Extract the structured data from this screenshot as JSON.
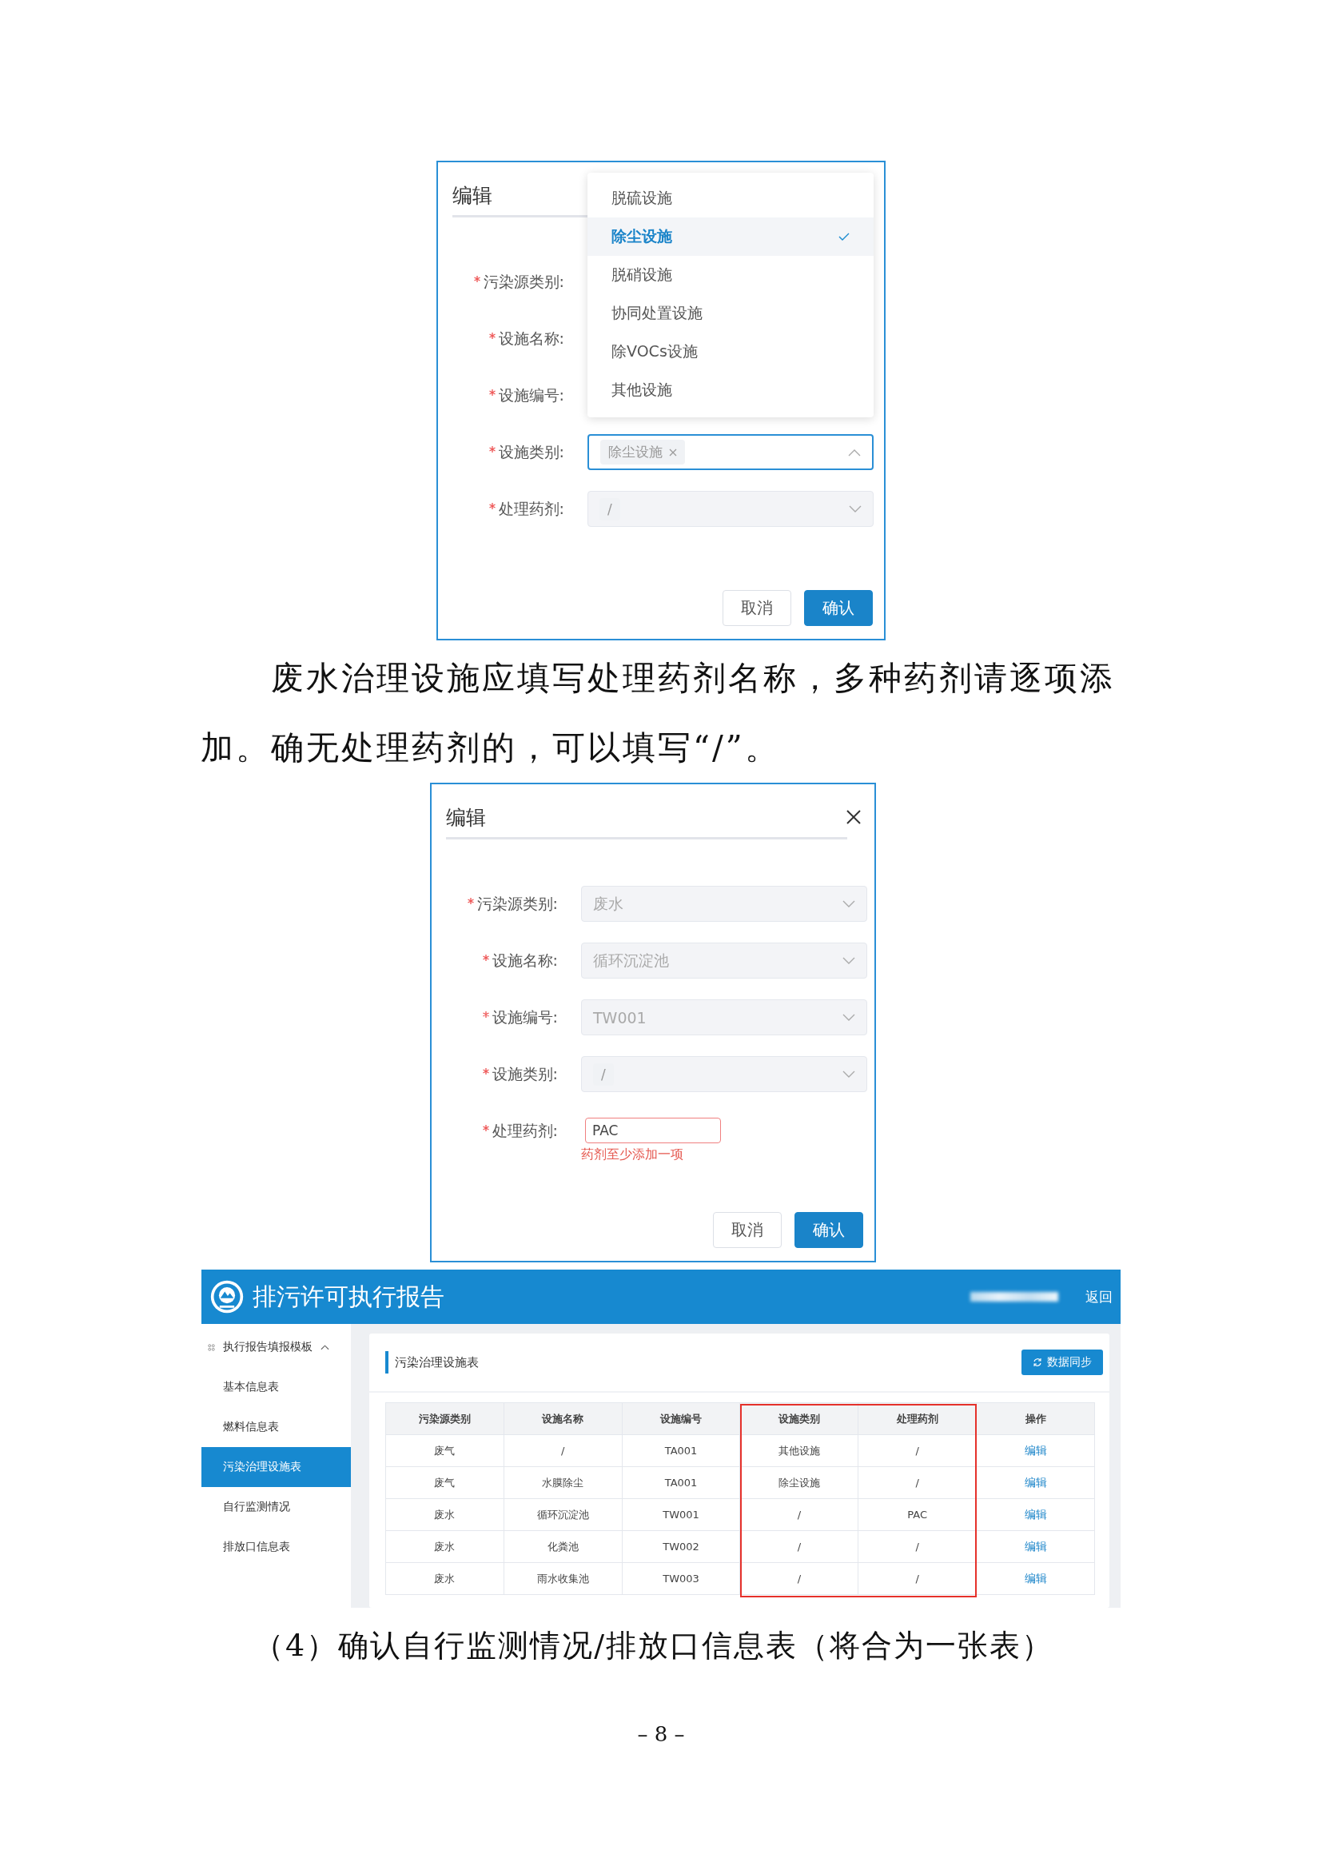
{
  "dialogs": [
    {
      "title": "编辑",
      "closable": false,
      "fields": [
        {
          "label": "污染源类别:",
          "required": true,
          "kind": "covered"
        },
        {
          "label": "设施名称:",
          "required": true,
          "kind": "covered"
        },
        {
          "label": "设施编号:",
          "required": true,
          "kind": "covered"
        },
        {
          "label": "设施类别:",
          "required": true,
          "kind": "tags",
          "tags": [
            "除尘设施"
          ],
          "focused": true,
          "disabled": false
        },
        {
          "label": "处理药剂:",
          "required": true,
          "kind": "tags",
          "tags": [
            "/"
          ],
          "focused": false,
          "disabled": true
        }
      ],
      "dropdown": {
        "options": [
          {
            "label": "脱硫设施",
            "selected": false
          },
          {
            "label": "除尘设施",
            "selected": true
          },
          {
            "label": "脱硝设施",
            "selected": false
          },
          {
            "label": "协同处置设施",
            "selected": false
          },
          {
            "label": "除VOCs设施",
            "selected": false
          },
          {
            "label": "其他设施",
            "selected": false
          }
        ]
      },
      "buttons": [
        {
          "label": "取消",
          "primary": false
        },
        {
          "label": "确认",
          "primary": true
        }
      ]
    },
    {
      "title": "编辑",
      "closable": true,
      "fields": [
        {
          "label": "污染源类别:",
          "required": true,
          "kind": "select",
          "value": "废水",
          "focused": false,
          "disabled": true
        },
        {
          "label": "设施名称:",
          "required": true,
          "kind": "select",
          "value": "循环沉淀池",
          "focused": false,
          "disabled": true
        },
        {
          "label": "设施编号:",
          "required": true,
          "kind": "select",
          "value": "TW001",
          "focused": false,
          "disabled": true
        },
        {
          "label": "设施类别:",
          "required": true,
          "kind": "tags",
          "tags": [
            "/"
          ],
          "focused": false,
          "disabled": true
        },
        {
          "label": "处理药剂:",
          "required": true,
          "kind": "input",
          "value": "PAC",
          "error": "药剂至少添加一项"
        }
      ],
      "buttons": [
        {
          "label": "取消",
          "primary": false
        },
        {
          "label": "确认",
          "primary": true
        }
      ]
    }
  ],
  "paragraph": "废水治理设施应填写处理药剂名称，多种药剂请逐项添加。确无处理药剂的，可以填写“/”。",
  "app": {
    "header": {
      "title": "排污许可执行报告",
      "action": "返回"
    },
    "sidebar": {
      "group": {
        "label": "执行报告填报模板",
        "expanded": true,
        "items": [
          {
            "label": "基本信息表",
            "selected": false
          },
          {
            "label": "燃料信息表",
            "selected": false
          },
          {
            "label": "污染治理设施表",
            "selected": true
          },
          {
            "label": "自行监测情况",
            "selected": false
          },
          {
            "label": "排放口信息表",
            "selected": false
          }
        ]
      }
    },
    "panel": {
      "title": "污染治理设施表",
      "button": "数据同步",
      "table": {
        "columns": [
          {
            "label": "污染源类别",
            "highlighted": false
          },
          {
            "label": "设施名称",
            "highlighted": false
          },
          {
            "label": "设施编号",
            "highlighted": false
          },
          {
            "label": "设施类别",
            "highlighted": true
          },
          {
            "label": "处理药剂",
            "highlighted": true
          },
          {
            "label": "操作",
            "highlighted": false
          }
        ],
        "rows": [
          {
            "cells": [
              "废气",
              "/",
              "TA001",
              "其他设施",
              "/"
            ],
            "action": "编辑"
          },
          {
            "cells": [
              "废气",
              "水膜除尘",
              "TA001",
              "除尘设施",
              "/"
            ],
            "action": "编辑"
          },
          {
            "cells": [
              "废水",
              "循环沉淀池",
              "TW001",
              "/",
              "PAC"
            ],
            "action": "编辑"
          },
          {
            "cells": [
              "废水",
              "化粪池",
              "TW002",
              "/",
              "/"
            ],
            "action": "编辑"
          },
          {
            "cells": [
              "废水",
              "雨水收集池",
              "TW003",
              "/",
              "/"
            ],
            "action": "编辑"
          }
        ]
      }
    }
  },
  "heading": "（4）确认自行监测情况/排放口信息表（将合为一张表）",
  "page_number": "– 8 –"
}
